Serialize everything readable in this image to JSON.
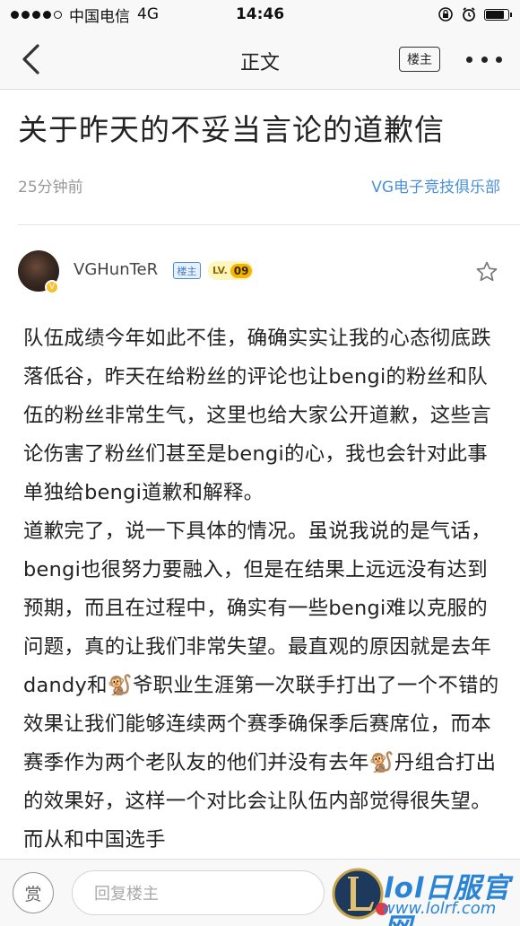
{
  "status_bar": {
    "carrier": "中国电信",
    "network": "4G",
    "time": "14:46"
  },
  "nav": {
    "title": "正文",
    "op_button": "楼主"
  },
  "article": {
    "title": "关于昨天的不妥当言论的道歉信",
    "time_ago": "25分钟前",
    "source": "VG电子竞技俱乐部"
  },
  "author": {
    "name": "VGHunTeR",
    "op_badge": "楼主",
    "level_prefix": "LV.",
    "level": "09"
  },
  "body": {
    "paragraph_1": "队伍成绩今年如此不佳，确确实实让我的心态彻底跌落低谷，昨天在给粉丝的评论也让bengi的粉丝和队伍的粉丝非常生气，这里也给大家公开道歉，这些言论伤害了粉丝们甚至是bengi的心，我也会针对此事单独给bengi道歉和解释。",
    "paragraph_2": "道歉完了，说一下具体的情况。虽说我说的是气话，bengi也很努力要融入，但是在结果上远远没有达到预期，而且在过程中，确实有一些bengi难以克服的问题，真的让我们非常失望。最直观的原因就是去年dandy和🐒爷职业生涯第一次联手打出了一个不错的效果让我们能够连续两个赛季确保季后赛席位，而本赛季作为两个老队友的他们并没有去年🐒丹组合打出的效果好，这样一个对比会让队伍内部觉得很失望。而从和中国选手"
  },
  "bottom_bar": {
    "reward_label": "赏",
    "reply_placeholder": "回复楼主"
  },
  "watermark": {
    "brand": "lol日服官网",
    "url": "www.lolrf.com"
  },
  "colors": {
    "link_blue": "#4a90d9",
    "badge_blue": "#3b7dc8",
    "level_gold": "#f4b400",
    "watermark_blue": "#2a84d6"
  },
  "battery_level_percent": 85
}
